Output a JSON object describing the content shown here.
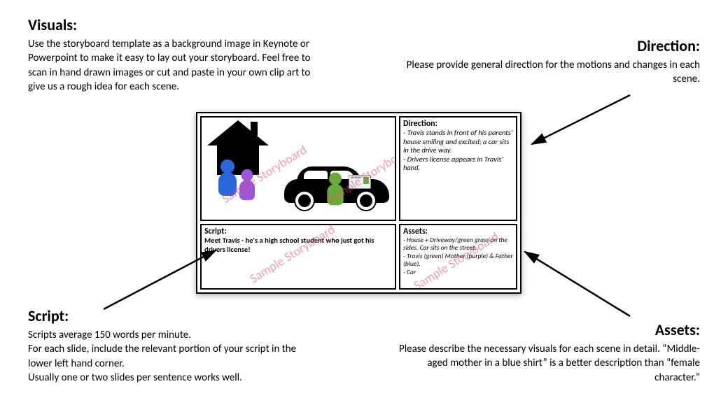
{
  "labels": {
    "visuals": {
      "heading": "Visuals:",
      "body": "Use the storyboard template as a background image in Keynote or Powerpoint to make it easy to lay out your storyboard. Feel free to scan in hand drawn images or cut and paste in your own clip art to give us a rough idea for each scene."
    },
    "direction": {
      "heading": "Direction:",
      "body": "Please provide general direction for the motions and changes in each scene."
    },
    "script": {
      "heading": "Script:",
      "body": "Scripts average 150 words per minute.\nFor each slide, include the relevant portion of your script in the lower left hand corner.\nUsually one or two slides per sentence works well."
    },
    "assets": {
      "heading": "Assets:",
      "body": "Please describe the necessary visuals for each scene in detail. “Middle-aged mother in a blue shirt” is a better description than “female character.”"
    }
  },
  "card": {
    "direction": {
      "label": "Direction:",
      "text": "- Travis stands in front of his parents' house smiling and excited; a car sits in the drive way.\n- Drivers license appears in Travis' hand."
    },
    "script": {
      "label": "Script:",
      "text": "Meet Travis - he's a high school student who just got his drivers license!"
    },
    "assets": {
      "label": "Assets:",
      "text": "- House + Driveway/green grass on the sides. Car sits on the street.\n- Travis (green) Mother (purple) & Father (blue).\n- Car"
    },
    "visual": {
      "license_label": "License"
    }
  },
  "watermark": "Sample Storyboard",
  "colors": {
    "father": "#2a67d8",
    "mother": "#9a56d8",
    "travis": "#6aaa3a",
    "watermark": "rgba(220,80,110,0.55)"
  }
}
